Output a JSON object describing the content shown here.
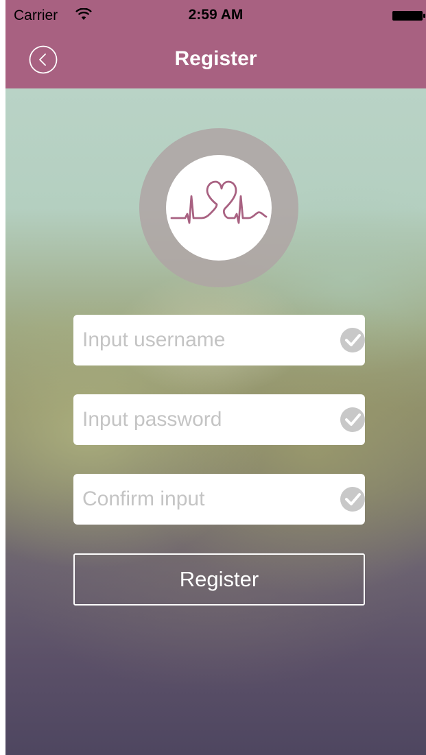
{
  "status_bar": {
    "carrier": "Carrier",
    "time": "2:59 AM",
    "wifi_icon": "wifi-icon",
    "battery_icon": "battery-icon"
  },
  "nav": {
    "title": "Register",
    "back_icon": "chevron-left-circle-icon"
  },
  "logo": {
    "icon": "heartbeat-heart-icon",
    "accent_color": "#a86181"
  },
  "form": {
    "username_placeholder": "Input username",
    "password_placeholder": "Input password",
    "confirm_placeholder": "Confirm input",
    "check_icon": "checkmark-circle-icon",
    "register_label": "Register"
  },
  "colors": {
    "header": "#a86181",
    "check": "#c8c8c8"
  }
}
